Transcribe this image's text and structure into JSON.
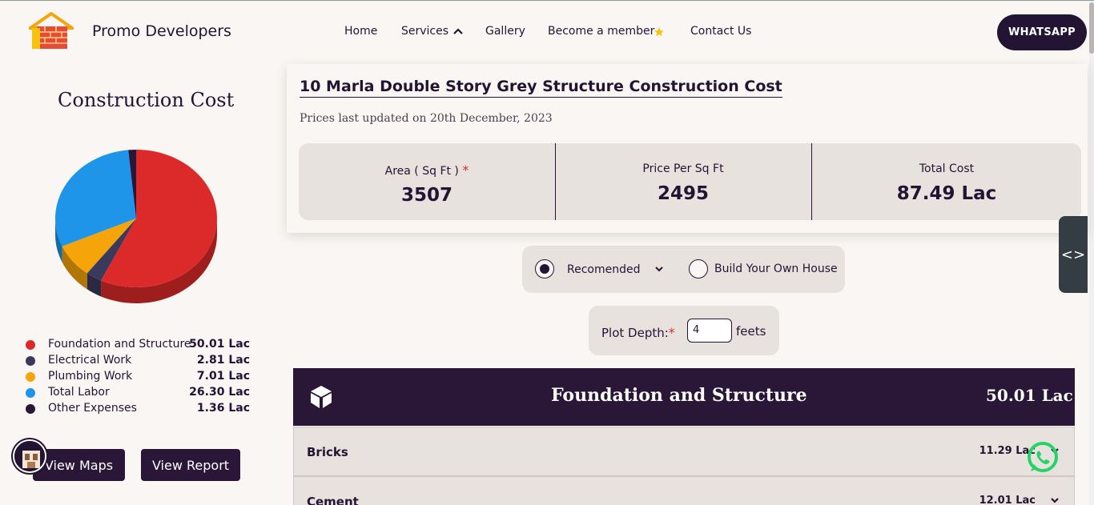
{
  "header": {
    "brand": "Promo Developers",
    "nav": {
      "home": "Home",
      "services": "Services",
      "gallery": "Gallery",
      "member": "Become a member",
      "contact": "Contact Us"
    },
    "whatsapp_label": "WHATSAPP"
  },
  "left": {
    "title": "Construction Cost",
    "legend": [
      {
        "label": "Foundation and Structure",
        "value": "50.01 Lac",
        "color": "#dc2a2a"
      },
      {
        "label": "Electrical Work",
        "value": "2.81 Lac",
        "color": "#3b3a5c"
      },
      {
        "label": "Plumbing Work",
        "value": "7.01 Lac",
        "color": "#f5a50a"
      },
      {
        "label": "Total Labor",
        "value": "26.30 Lac",
        "color": "#1e95e8"
      },
      {
        "label": "Other Expenses",
        "value": "1.36 Lac",
        "color": "#2a1637"
      }
    ],
    "view_maps": "View Maps",
    "view_report": "View Report"
  },
  "chart_data": {
    "type": "pie",
    "categories": [
      "Foundation and Structure",
      "Electrical Work",
      "Plumbing Work",
      "Total Labor",
      "Other Expenses"
    ],
    "values": [
      50.01,
      2.81,
      7.01,
      26.3,
      1.36
    ],
    "colors": [
      "#dc2a2a",
      "#3b3a5c",
      "#f5a50a",
      "#1e95e8",
      "#2a1637"
    ]
  },
  "card": {
    "title": "10 Marla Double Story Grey Structure Construction Cost",
    "updated": "Prices last updated on 20th December, 2023",
    "stats": [
      {
        "label": "Area ( Sq Ft )",
        "value": "3507",
        "required": "*"
      },
      {
        "label": "Price Per Sq Ft",
        "value": "2495"
      },
      {
        "label": "Total Cost",
        "value": "87.49 Lac"
      }
    ]
  },
  "options": {
    "recommended": "Recomended",
    "build_own": "Build Your Own House"
  },
  "depth": {
    "label": "Plot Depth:",
    "required": "*",
    "value": "4",
    "unit": "feets"
  },
  "category": {
    "title": "Foundation and Structure",
    "total": "50.01 Lac",
    "items": [
      {
        "name": "Bricks",
        "value": "11.29 Lac"
      },
      {
        "name": "Cement",
        "value": "12.01 Lac"
      }
    ]
  },
  "code_tab_icon": "<>"
}
